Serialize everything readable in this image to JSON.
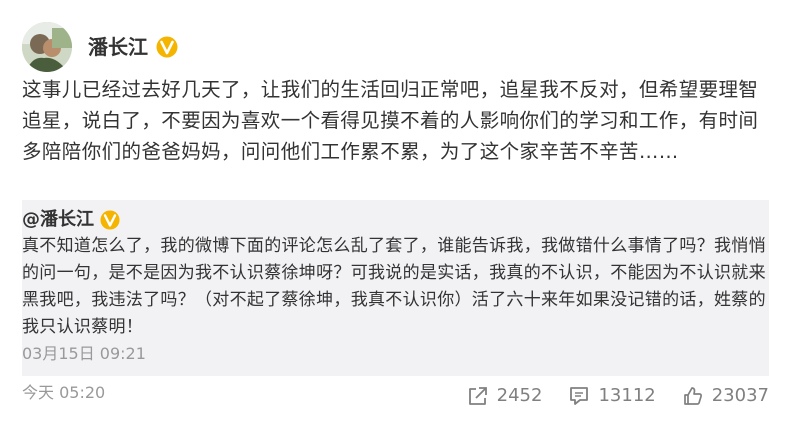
{
  "post": {
    "author": "潘长江",
    "text": "这事儿已经过去好几天了，让我们的生活回归正常吧，追星我不反对，但希望要理智追星，说白了，不要因为喜欢一个看得见摸不着的人影响你们的学习和工作，有时间多陪陪你们的爸爸妈妈，问问他们工作累不累，为了这个家辛苦不辛苦……",
    "time": "今天 05:20"
  },
  "quote": {
    "author": "@潘长江",
    "text": "真不知道怎么了，我的微博下面的评论怎么乱了套了，谁能告诉我，我做错什么事情了吗？我悄悄的问一句，是不是因为我不认识蔡徐坤呀？可我说的是实话，我真的不认识，不能因为不认识就来黑我吧，我违法了吗？（对不起了蔡徐坤，我真不认识你）活了六十来年如果没记错的话，姓蔡的我只认识蔡明！",
    "time": "03月15日 09:21"
  },
  "actions": {
    "forward": "2452",
    "comment": "13112",
    "like": "23037"
  },
  "colors": {
    "badge": "#f5b400",
    "quote_bg": "#f2f2f5",
    "muted": "#999999"
  },
  "icons": {
    "verified": "verified-badge-icon",
    "forward": "share-icon",
    "comment": "comment-icon",
    "like": "thumbs-up-icon"
  }
}
